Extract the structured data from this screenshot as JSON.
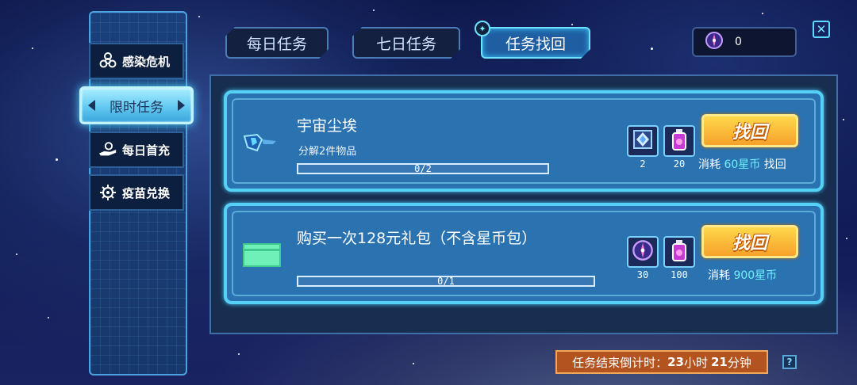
{
  "sidebar": {
    "items": [
      {
        "label": "感染危机",
        "icon": "biohazard-icon"
      },
      {
        "label": "限时任务",
        "icon": "none",
        "active": true
      },
      {
        "label": "每日首充",
        "icon": "hand-coin-icon"
      },
      {
        "label": "疫苗兑换",
        "icon": "virus-icon"
      }
    ]
  },
  "tabs": [
    {
      "label": "每日任务",
      "active": false
    },
    {
      "label": "七日任务",
      "active": false
    },
    {
      "label": "任务找回",
      "active": true
    }
  ],
  "currency": {
    "icon": "compass-coin-icon",
    "value": "0"
  },
  "tasks": [
    {
      "title": "宇宙尘埃",
      "desc": "分解2件物品",
      "progress": "0/2",
      "progress_fraction": 0,
      "rewards": [
        {
          "icon": "crystal-icon",
          "count": "2"
        },
        {
          "icon": "potion-icon",
          "count": "20"
        }
      ],
      "button": "找回",
      "cost_prefix": "消耗",
      "cost_amount": "60星币",
      "cost_suffix": "找回"
    },
    {
      "title": "购买一次128元礼包（不含星币包）",
      "desc": "",
      "progress": "0/1",
      "progress_fraction": 0,
      "rewards": [
        {
          "icon": "compass-coin-icon",
          "count": "30"
        },
        {
          "icon": "potion-icon",
          "count": "100"
        }
      ],
      "button": "找回",
      "cost_prefix": "消耗",
      "cost_amount": "900星币",
      "cost_suffix": ""
    }
  ],
  "countdown": {
    "label": "任务结束倒计时：",
    "hours": "23",
    "hours_unit": "小时",
    "minutes": "21",
    "minutes_unit": "分钟"
  },
  "help": "?",
  "colors": {
    "accent": "#55d1f5",
    "button": "#f6a12b",
    "highlight": "#6ff0ff",
    "countdown_bg": "#b35420"
  }
}
